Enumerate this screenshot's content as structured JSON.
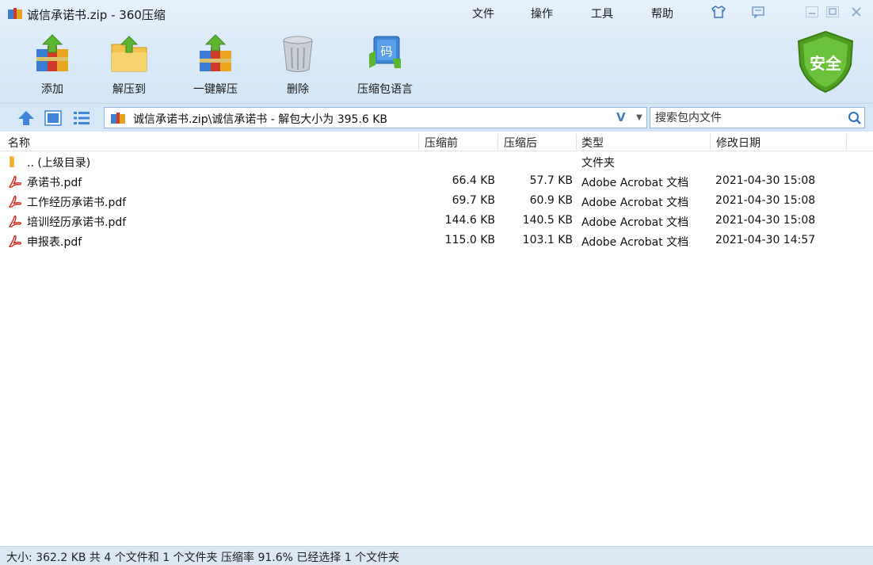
{
  "window": {
    "title": "诚信承诺书.zip - 360压缩",
    "menus": [
      "文件",
      "操作",
      "工具",
      "帮助"
    ],
    "controls": [
      "skin-icon",
      "feedback-icon",
      "minimize-icon",
      "maximize-icon",
      "close-icon"
    ]
  },
  "toolbar": {
    "add_label": "添加",
    "extract_to_label": "解压到",
    "one_click_extract_label": "一键解压",
    "delete_label": "删除",
    "language_label": "压缩包语言",
    "security_badge": "安全"
  },
  "address": {
    "path": "诚信承诺书.zip\\诚信承诺书 - 解包大小为 395.6 KB",
    "v_label": "V",
    "dropdown": "▼",
    "search_placeholder": "搜索包内文件"
  },
  "columns": {
    "name": "名称",
    "compressed_before": "压缩前",
    "compressed_after": "压缩后",
    "type": "类型",
    "modified": "修改日期"
  },
  "files": [
    {
      "name": ".. (上级目录)",
      "size": "",
      "packed": "",
      "type": "文件夹",
      "date": "",
      "icon": "folder-icon"
    },
    {
      "name": "承诺书.pdf",
      "size": "66.4 KB",
      "packed": "57.7 KB",
      "type": "Adobe Acrobat 文档",
      "date": "2021-04-30 15:08",
      "icon": "pdf-icon"
    },
    {
      "name": "工作经历承诺书.pdf",
      "size": "69.7 KB",
      "packed": "60.9 KB",
      "type": "Adobe Acrobat 文档",
      "date": "2021-04-30 15:08",
      "icon": "pdf-icon"
    },
    {
      "name": "培训经历承诺书.pdf",
      "size": "144.6 KB",
      "packed": "140.5 KB",
      "type": "Adobe Acrobat 文档",
      "date": "2021-04-30 15:08",
      "icon": "pdf-icon"
    },
    {
      "name": "申报表.pdf",
      "size": "115.0 KB",
      "packed": "103.1 KB",
      "type": "Adobe Acrobat 文档",
      "date": "2021-04-30 14:57",
      "icon": "pdf-icon"
    }
  ],
  "status": {
    "text": "大小: 362.2 KB 共 4 个文件和 1 个文件夹 压缩率 91.6% 已经选择 1 个文件夹"
  },
  "colors": {
    "accent": "#4a90d9",
    "toolbar_bg": "#dcebf8",
    "status_bg": "#dbe8f4",
    "shield_green": "#5aab2a"
  }
}
